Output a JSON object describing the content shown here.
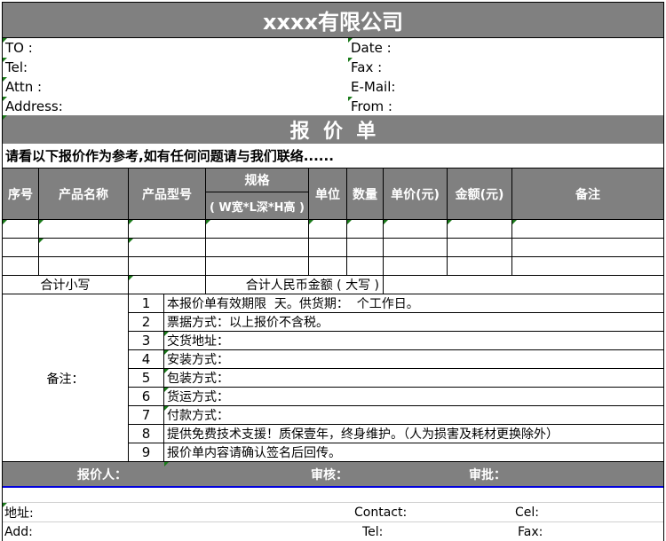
{
  "document": {
    "company_title": "xxxx有限公司",
    "info_left": [
      {
        "label": "TO :"
      },
      {
        "label": "Tel:"
      },
      {
        "label": "Attn  :"
      },
      {
        "label": "Address:"
      }
    ],
    "info_right": [
      {
        "label": "Date :"
      },
      {
        "label": "Fax :"
      },
      {
        "label": "E-Mail:"
      },
      {
        "label": "From :"
      }
    ],
    "quote_title": "报  价  单",
    "intro_text": "请看以下报价作为参考,如有任何问题请与我们联络......",
    "table": {
      "headers": {
        "seq": "序号",
        "product_name": "产品名称",
        "model": "产品型号",
        "spec": "规格",
        "spec_sub": "( W宽*L深*H高 )",
        "unit": "单位",
        "qty": "数量",
        "unit_price": "单价(元)",
        "amount": "金额(元)",
        "remark": "备注"
      },
      "rows": [
        {
          "seq": "",
          "product_name": "",
          "model": "",
          "spec": "",
          "unit": "",
          "qty": "",
          "unit_price": "",
          "amount": "",
          "remark": ""
        },
        {
          "seq": "",
          "product_name": "",
          "model": "",
          "spec": "",
          "unit": "",
          "qty": "",
          "unit_price": "",
          "amount": "",
          "remark": ""
        },
        {
          "seq": "",
          "product_name": "",
          "model": "",
          "spec": "",
          "unit": "",
          "qty": "",
          "unit_price": "",
          "amount": "",
          "remark": ""
        }
      ],
      "subtotal_label": "合计小写",
      "subtotal_value": "",
      "total_rmb_label": "合计人民币金额 ( 大写 )",
      "total_rmb_value": ""
    },
    "notes": {
      "label": "备注：",
      "items": [
        {
          "num": "1",
          "text": "本报价单有效期限  天。供货期：  个工作日。"
        },
        {
          "num": "2",
          "text": "票据方式：以上报价不含税。"
        },
        {
          "num": "3",
          "text": "交货地址："
        },
        {
          "num": "4",
          "text": "安装方式："
        },
        {
          "num": "5",
          "text": "包装方式："
        },
        {
          "num": "6",
          "text": "货运方式："
        },
        {
          "num": "7",
          "text": "付款方式："
        },
        {
          "num": "8",
          "text": "提供免费技术支援！质保壹年，终身维护。（人为损害及耗材更换除外）"
        },
        {
          "num": "9",
          "text": "报价单内容请确认签名后回传。"
        }
      ]
    },
    "signature": {
      "quoter": "报价人：",
      "reviewer": "审核：",
      "approver": "审批："
    },
    "footer": {
      "address_cn": "地址:",
      "contact": "Contact:",
      "cel": "Cel:",
      "address_en": "Add:",
      "tel": "Tel:",
      "fax": "Fax:"
    },
    "colors": {
      "header_gray": "#808080",
      "accent_blue": "#0000dd",
      "comment_marker": "#1a7a1a"
    }
  }
}
